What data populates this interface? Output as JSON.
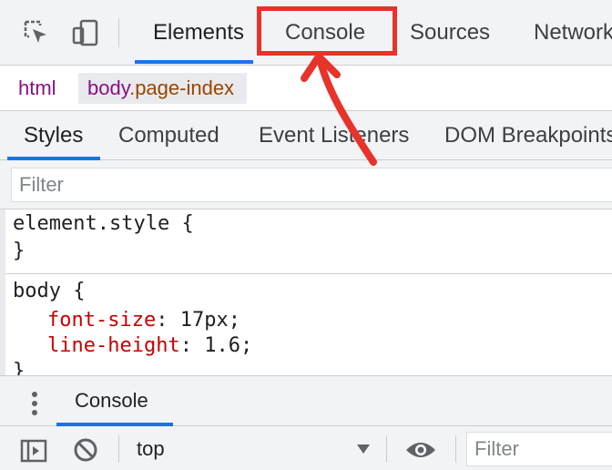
{
  "toolbar": {
    "tabs": [
      {
        "label": "Elements",
        "active": true
      },
      {
        "label": "Console",
        "active": false,
        "highlighted": true
      },
      {
        "label": "Sources",
        "active": false
      },
      {
        "label": "Network",
        "active": false
      }
    ],
    "icons": [
      "inspect-element-icon",
      "device-toggle-icon"
    ]
  },
  "breadcrumb": {
    "html": "html",
    "body_tag": "body",
    "body_class": ".page-index"
  },
  "styles_tabs": [
    {
      "label": "Styles",
      "active": true
    },
    {
      "label": "Computed",
      "active": false
    },
    {
      "label": "Event Listeners",
      "active": false
    },
    {
      "label": "DOM Breakpoints",
      "active": false
    }
  ],
  "filter": {
    "placeholder": "Filter"
  },
  "rules": {
    "element_style": {
      "selector": "element.style",
      "open": "{",
      "close": "}"
    },
    "body": {
      "selector": "body",
      "open": "{",
      "close": "}",
      "declarations": [
        {
          "property": "font-size",
          "value": "17px;"
        },
        {
          "property": "line-height",
          "value": "1.6;"
        }
      ]
    }
  },
  "drawer": {
    "tab": "Console",
    "context": "top",
    "filter_placeholder": "Filter"
  },
  "colors": {
    "accent": "#1a73e8",
    "annotation_red": "#e8332a",
    "tag": "#881280",
    "class": "#994500",
    "property": "#c80000"
  }
}
